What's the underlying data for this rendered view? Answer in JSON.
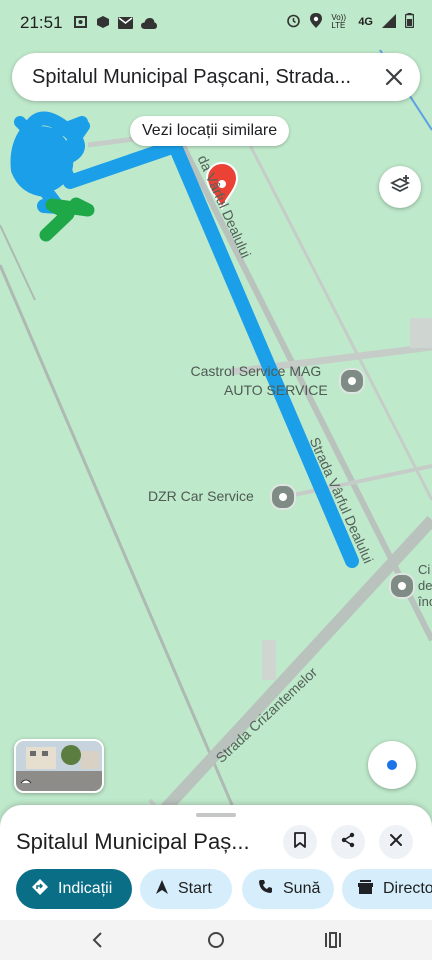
{
  "status_bar": {
    "time": "21:51",
    "left_icons": [
      "screen-record-icon",
      "package-icon",
      "mail-icon",
      "cloud-icon"
    ],
    "right_icons": [
      "alarm-icon",
      "location-icon",
      "volte-icon",
      "signal-icon",
      "battery-icon"
    ],
    "network": "4G",
    "volte": "Vo)) LTE"
  },
  "search": {
    "query": "Spitalul Municipal Pașcani, Strada...",
    "close_icon": "close-icon"
  },
  "map": {
    "similar_chip": "Vezi locații similare",
    "street_vf_dealului_top": "da Vârful Dealului",
    "street_vf_dealului_bottom": "Strada Vârful Dealului",
    "street_crizantemelor": "Strada Crizantemelor",
    "poi_castrol_line1": "Castrol Service MAG",
    "poi_castrol_line2": "AUTO SERVICE",
    "poi_dzr": "DZR Car Service",
    "poi_church_line1": "Ci",
    "poi_church_line2": "de",
    "poi_church_line3": "îno",
    "marker_color": "#ea4335",
    "route_color": "#1a9fe8",
    "scribble_green_color": "#1fa848"
  },
  "sheet": {
    "title": "Spitalul Municipal Paș...",
    "save_icon": "bookmark-icon",
    "share_icon": "share-icon",
    "close_icon": "close-icon",
    "actions": [
      {
        "label": "Indicații",
        "icon": "directions-icon"
      },
      {
        "label": "Start",
        "icon": "navigation-arrow-icon"
      },
      {
        "label": "Sună",
        "icon": "phone-icon"
      },
      {
        "label": "Director",
        "icon": "directory-icon"
      }
    ]
  },
  "nav": {
    "back": "back-icon",
    "home": "home-icon",
    "recents": "recents-icon"
  }
}
